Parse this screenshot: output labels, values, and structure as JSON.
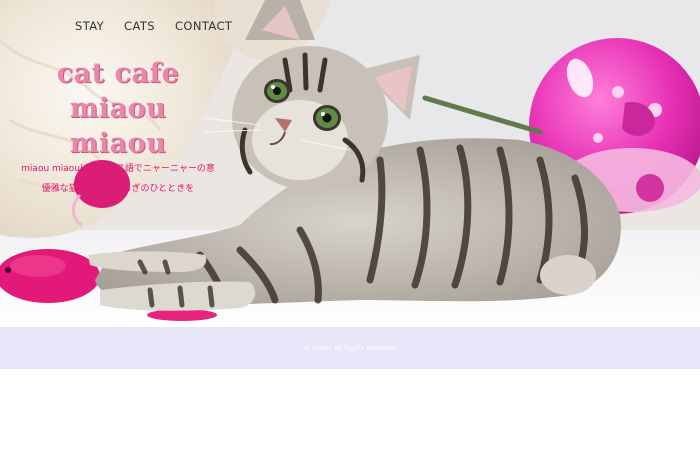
{
  "nav": {
    "items": [
      {
        "label": "STAY"
      },
      {
        "label": "CATS"
      },
      {
        "label": "CONTACT"
      }
    ]
  },
  "brand": {
    "title_lines": [
      "cat cafe",
      "miaou",
      "miaou"
    ]
  },
  "tagline": {
    "lines": [
      "miaou miaouはフランス語でニャーニャーの意味",
      "優雅な猫たちとくつろぎのひとときを"
    ]
  },
  "footer": {
    "copyright": "© miaou All Rights Reserved"
  },
  "colors": {
    "brand_pink": "#ea86a8",
    "tagline_magenta": "#e0156b",
    "footer_bg": "#e8e7fa"
  }
}
